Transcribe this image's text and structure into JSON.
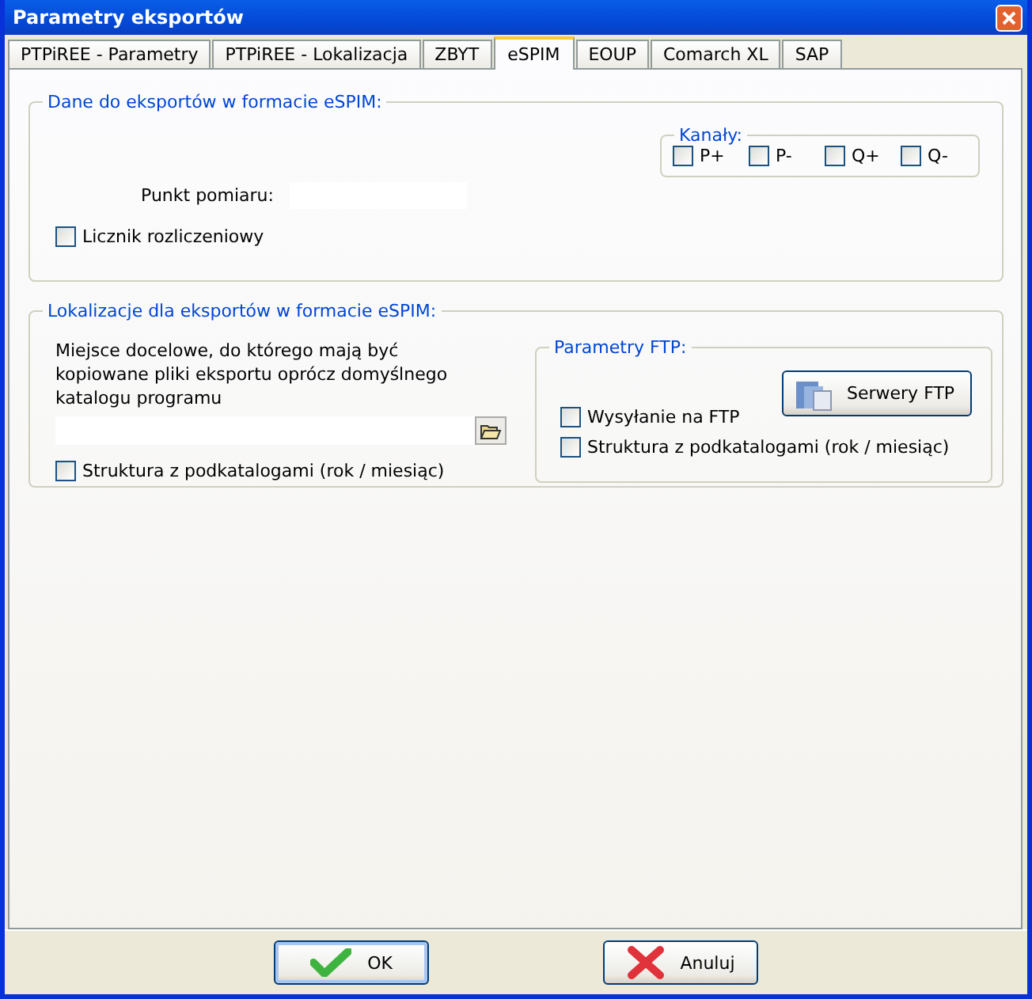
{
  "window": {
    "title": "Parametry eksportów"
  },
  "tabs": [
    {
      "label": "PTPiREE - Parametry",
      "selected": false
    },
    {
      "label": "PTPiREE - Lokalizacja",
      "selected": false
    },
    {
      "label": "ZBYT",
      "selected": false
    },
    {
      "label": "eSPIM",
      "selected": true
    },
    {
      "label": "EOUP",
      "selected": false
    },
    {
      "label": "Comarch XL",
      "selected": false
    },
    {
      "label": "SAP",
      "selected": false
    }
  ],
  "data_group": {
    "title": "Dane do eksportów w formacie eSPIM:",
    "channels": {
      "title": "Kanały:",
      "items": [
        {
          "label": "P+",
          "checked": false
        },
        {
          "label": "P-",
          "checked": false
        },
        {
          "label": "Q+",
          "checked": false
        },
        {
          "label": "Q-",
          "checked": false
        }
      ]
    },
    "measurement_point_label": "Punkt pomiaru:",
    "billing_meter": {
      "label": "Licznik rozliczeniowy",
      "checked": false
    }
  },
  "location_group": {
    "title": "Lokalizacje dla eksportów w formacie eSPIM:",
    "description": "Miejsce docelowe, do którego mają być kopiowane pliki eksportu oprócz domyślnego katalogu programu",
    "subfolders": {
      "label": "Struktura z podkatalogami (rok / miesiąc)",
      "checked": false
    },
    "ftp": {
      "title": "Parametry FTP:",
      "servers_button": "Serwery FTP",
      "send": {
        "label": "Wysyłanie na FTP",
        "checked": false
      },
      "subfolders": {
        "label": "Struktura z podkatalogami (rok / miesiąc)",
        "checked": false
      }
    }
  },
  "buttons": [
    {
      "label": "OK",
      "kind": "ok"
    },
    {
      "label": "Anuluj",
      "kind": "cancel"
    }
  ]
}
